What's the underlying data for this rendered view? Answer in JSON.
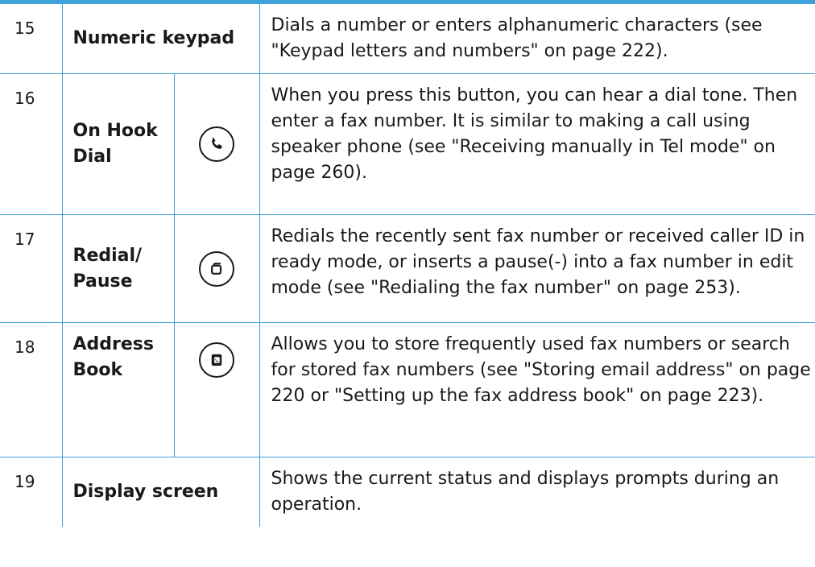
{
  "rows": [
    {
      "number": "15",
      "name": "Numeric keypad",
      "description": "Dials a number or enters alphanumeric characters (see \"Keypad letters and numbers\" on page 222)."
    },
    {
      "number": "16",
      "name_line1": "On Hook",
      "name_line2": "Dial",
      "icon": "phone-handset-icon",
      "description": "When you press this button, you can hear a dial tone. Then enter a fax number. It is similar to making a call using speaker phone (see \"Receiving manually in Tel mode\" on page 260)."
    },
    {
      "number": "17",
      "name_line1": "Redial/",
      "name_line2": "Pause",
      "icon": "redial-pause-icon",
      "description": "Redials the recently sent fax number or received caller ID in ready mode, or inserts a pause(-) into a fax number in edit mode (see \"Redialing the fax number\" on page 253)."
    },
    {
      "number": "18",
      "name_line1": "Address",
      "name_line2": "Book",
      "icon": "address-book-icon",
      "description": "Allows you to store frequently used fax numbers or search for stored fax numbers (see \"Storing email address\" on page 220 or \"Setting up the fax address book\" on page 223)."
    },
    {
      "number": "19",
      "name": "Display screen",
      "description": "Shows the current status and displays prompts during an operation."
    }
  ],
  "colors": {
    "rule": "#3fa2d9",
    "text": "#1a1a1a"
  }
}
